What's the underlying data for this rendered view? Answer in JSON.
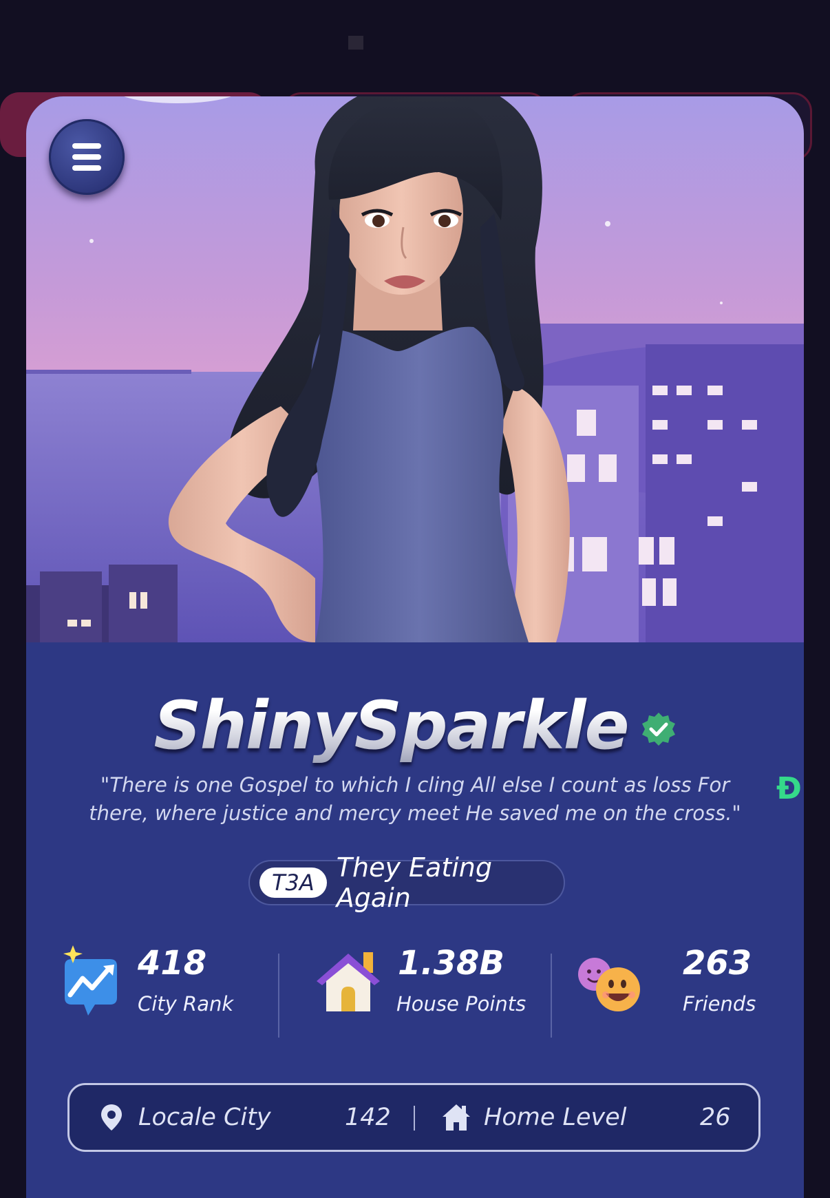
{
  "profile": {
    "username": "ShinySparkle",
    "verified": true,
    "bio": "\"There is one Gospel to which I cling All else I count as loss  For there, where justice and mercy meet  He saved me on the cross.\"",
    "side_glyph": "Đ",
    "crew": {
      "tag": "T3A",
      "name": "They Eating Again"
    }
  },
  "stats": [
    {
      "value": "418",
      "label": "City Rank",
      "icon": "city-rank-chart-icon"
    },
    {
      "value": "1.38B",
      "label": "House Points",
      "icon": "house-icon"
    },
    {
      "value": "263",
      "label": "Friends",
      "icon": "smiley-faces-icon"
    }
  ],
  "location": {
    "locale_label": "Locale City",
    "locale_value": "142",
    "home_label": "Home Level",
    "home_value": "26"
  },
  "background_tab_text": ")",
  "colors": {
    "card_blue": "#2d3884",
    "verified_green": "#3fae73",
    "side_glyph_green": "#35d98a",
    "background_dark": "#120f22"
  }
}
